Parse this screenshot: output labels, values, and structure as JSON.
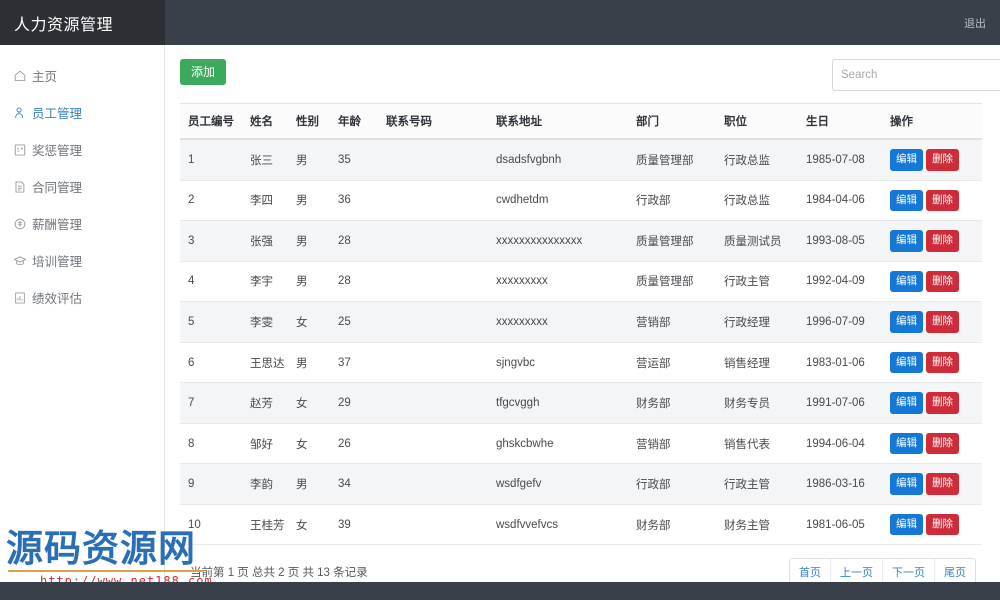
{
  "header": {
    "brand": "人力资源管理",
    "logout_label": "退出"
  },
  "sidebar": {
    "items": [
      {
        "label": "主页",
        "icon": "home-icon",
        "active": false
      },
      {
        "label": "员工管理",
        "icon": "user-icon",
        "active": true
      },
      {
        "label": "奖惩管理",
        "icon": "clipboard-icon",
        "active": false
      },
      {
        "label": "合同管理",
        "icon": "document-icon",
        "active": false
      },
      {
        "label": "薪酬管理",
        "icon": "coin-icon",
        "active": false
      },
      {
        "label": "培训管理",
        "icon": "graduation-icon",
        "active": false
      },
      {
        "label": "绩效评估",
        "icon": "report-icon",
        "active": false
      }
    ]
  },
  "toolbar": {
    "add_label": "添加",
    "search_placeholder": "Search",
    "search_value": "",
    "search_icon": "search-icon"
  },
  "table": {
    "columns": [
      "员工编号",
      "姓名",
      "性别",
      "年龄",
      "联系号码",
      "联系地址",
      "部门",
      "职位",
      "生日",
      "操作"
    ],
    "row_actions": {
      "edit_label": "编辑",
      "delete_label": "删除"
    },
    "rows": [
      {
        "id": "1",
        "name": "张三",
        "sex": "男",
        "age": "35",
        "phone": "",
        "address": "dsadsfvgbnh",
        "dept": "质量管理部",
        "position": "行政总监",
        "birthday": "1985-07-08"
      },
      {
        "id": "2",
        "name": "李四",
        "sex": "男",
        "age": "36",
        "phone": "",
        "address": "cwdhetdm",
        "dept": "行政部",
        "position": "行政总监",
        "birthday": "1984-04-06"
      },
      {
        "id": "3",
        "name": "张强",
        "sex": "男",
        "age": "28",
        "phone": "",
        "address": "xxxxxxxxxxxxxxx",
        "dept": "质量管理部",
        "position": "质量测试员",
        "birthday": "1993-08-05"
      },
      {
        "id": "4",
        "name": "李宇",
        "sex": "男",
        "age": "28",
        "phone": "",
        "address": "xxxxxxxxx",
        "dept": "质量管理部",
        "position": "行政主管",
        "birthday": "1992-04-09"
      },
      {
        "id": "5",
        "name": "李雯",
        "sex": "女",
        "age": "25",
        "phone": "",
        "address": "xxxxxxxxx",
        "dept": "营销部",
        "position": "行政经理",
        "birthday": "1996-07-09"
      },
      {
        "id": "6",
        "name": "王思达",
        "sex": "男",
        "age": "37",
        "phone": "",
        "address": "sjngvbc",
        "dept": "营运部",
        "position": "销售经理",
        "birthday": "1983-01-06"
      },
      {
        "id": "7",
        "name": "赵芳",
        "sex": "女",
        "age": "29",
        "phone": "",
        "address": "tfgcvggh",
        "dept": "财务部",
        "position": "财务专员",
        "birthday": "1991-07-06"
      },
      {
        "id": "8",
        "name": "邹好",
        "sex": "女",
        "age": "26",
        "phone": "",
        "address": "ghskcbwhe",
        "dept": "营销部",
        "position": "销售代表",
        "birthday": "1994-06-04"
      },
      {
        "id": "9",
        "name": "李韵",
        "sex": "男",
        "age": "34",
        "phone": "",
        "address": "wsdfgefv",
        "dept": "行政部",
        "position": "行政主管",
        "birthday": "1986-03-16"
      },
      {
        "id": "10",
        "name": "王桂芳",
        "sex": "女",
        "age": "39",
        "phone": "",
        "address": "wsdfvvefvcs",
        "dept": "财务部",
        "position": "财务主管",
        "birthday": "1981-06-05"
      }
    ]
  },
  "footer": {
    "page_info": "当前第 1 页 总共 2 页 共 13 条记录",
    "pager": [
      {
        "label": "首页"
      },
      {
        "label": "上一页"
      },
      {
        "label": "下一页"
      },
      {
        "label": "尾页"
      }
    ]
  },
  "watermark": {
    "text": "源码资源网",
    "url": "http://www.net188.com"
  }
}
